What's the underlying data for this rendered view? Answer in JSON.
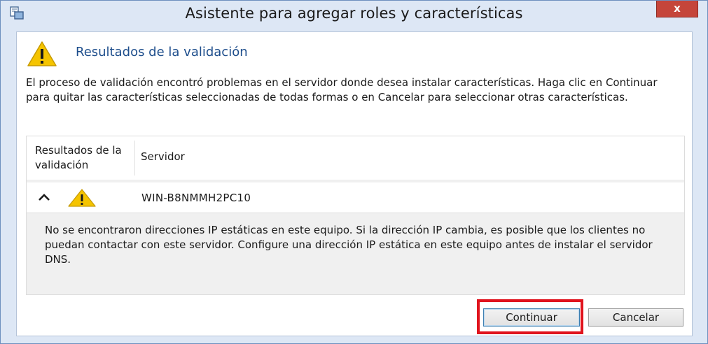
{
  "window": {
    "title": "Asistente para agregar roles y características",
    "close_label": "x"
  },
  "header": {
    "title": "Resultados de la validación"
  },
  "intro": {
    "text": "El proceso de validación encontró problemas en el servidor donde desea instalar características. Haga clic en Continuar para quitar las características seleccionadas de todas formas o en Cancelar para seleccionar otras características."
  },
  "results": {
    "columns": [
      "Resultados de la validación",
      "Servidor"
    ],
    "groups": [
      {
        "server": "WIN-B8NMMH2PC10",
        "status_icon": "warning-icon",
        "expanded": true,
        "message": "No se encontraron direcciones IP estáticas en este equipo. Si la dirección IP cambia, es posible que los clientes no puedan contactar con este servidor. Configure una dirección IP estática en este equipo antes de instalar el servidor DNS."
      }
    ]
  },
  "buttons": {
    "continue_label": "Continuar",
    "cancel_label": "Cancelar"
  },
  "icons": {
    "app": "server-manager-icon",
    "header": "warning-icon",
    "toggle": "chevron-up-icon"
  },
  "colors": {
    "accent_title": "#1e4e8c",
    "warning_fill": "#f5c400",
    "highlight": "#e0141e",
    "close_button": "#c5453a"
  }
}
